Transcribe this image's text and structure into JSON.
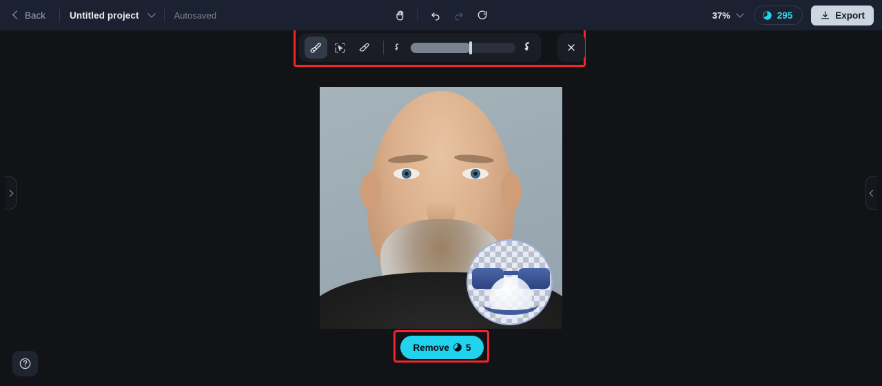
{
  "header": {
    "back_label": "Back",
    "project_name": "Untitled project",
    "autosave_status": "Autosaved",
    "zoom_level": "37%",
    "credits_count": "295",
    "export_label": "Export",
    "center_tools": [
      {
        "name": "hand-tool-icon",
        "label": "Hand"
      },
      {
        "name": "undo-icon",
        "label": "Undo"
      },
      {
        "name": "redo-icon",
        "label": "Redo"
      },
      {
        "name": "reset-icon",
        "label": "Reset"
      }
    ]
  },
  "toolbar": {
    "tools": [
      {
        "name": "brush-tool",
        "label": "Brush",
        "active": true
      },
      {
        "name": "magic-select-tool",
        "label": "Magic select",
        "active": false
      },
      {
        "name": "eraser-tool",
        "label": "Eraser",
        "active": false
      }
    ],
    "brush_size_percent": "57",
    "small_brush_label": "Small brush",
    "large_brush_label": "Large brush",
    "close_label": "Close"
  },
  "canvas": {
    "image_alt": "Portrait of a smiling bald man with a grey beard",
    "brush_cursor_label": "Brush cursor preview",
    "sticker_label": "Sunglasses emoji"
  },
  "actions": {
    "remove_label": "Remove",
    "remove_cost": "5"
  },
  "panels": {
    "left_tab_label": "Open left panel",
    "right_tab_label": "Open right panel",
    "help_label": "Help"
  },
  "colors": {
    "accent_cyan": "#22d3ee",
    "credit_cyan": "#34d9ef",
    "annotation_red": "#f3252b",
    "header_bg": "#1b2130",
    "canvas_bg": "#121317"
  }
}
